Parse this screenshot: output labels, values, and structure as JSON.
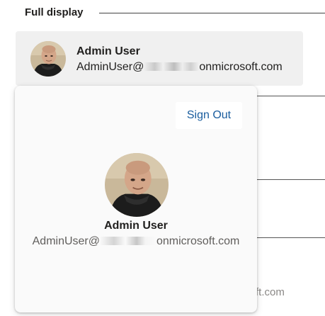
{
  "section": {
    "title": "Full display"
  },
  "persona": {
    "name": "Admin User",
    "email_prefix": "AdminUser@",
    "email_suffix": "onmicrosoft.com"
  },
  "card": {
    "sign_out_label": "Sign Out",
    "name": "Admin User",
    "email_prefix": "AdminUser@",
    "email_suffix": "onmicrosoft.com"
  },
  "background": {
    "partial_email_text": "ft.com"
  },
  "colors": {
    "link_blue": "#1a5d9e",
    "persona_bg": "#f0f0f0",
    "card_bg": "#fafafa"
  },
  "icons": {
    "avatar": "user-photo"
  }
}
